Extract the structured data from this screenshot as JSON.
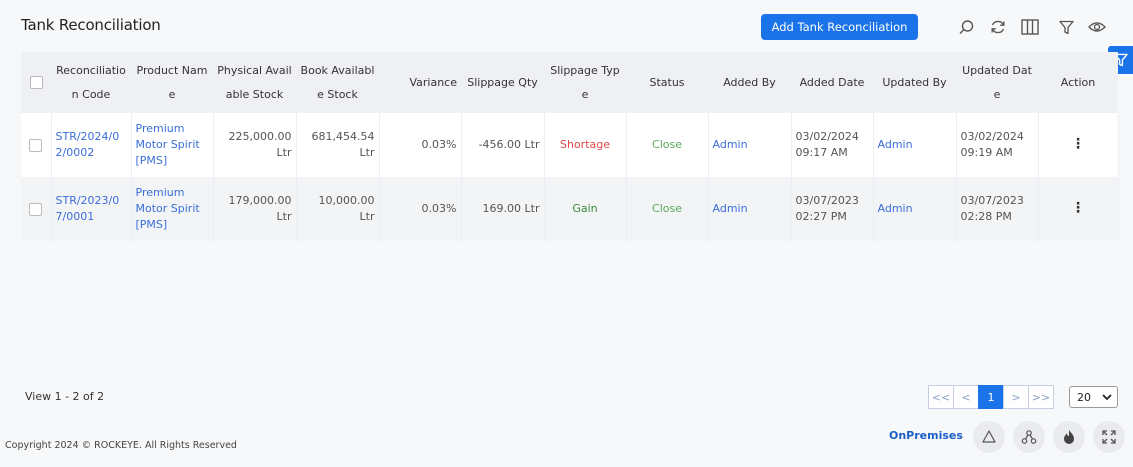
{
  "page": {
    "title": "Tank Reconciliation",
    "add_button": "Add Tank Reconciliation"
  },
  "toolbar": {
    "icons": [
      "search-icon",
      "refresh-icon",
      "columns-icon",
      "filter-icon",
      "eye-icon"
    ]
  },
  "table": {
    "columns": [
      "Reconciliation Code",
      "Product Name",
      "Physical Available Stock",
      "Book Available Stock",
      "Variance",
      "Slippage Qty",
      "Slippage Type",
      "Status",
      "Added By",
      "Added Date",
      "Updated By",
      "Updated Date",
      "Action"
    ],
    "rows": [
      {
        "code": "STR/2024/02/0002",
        "product": "Premium Motor Spirit [PMS]",
        "physical": "225,000.00 Ltr",
        "book": "681,454.54 Ltr",
        "variance": "0.03%",
        "slippage_qty": "-456.00 Ltr",
        "slippage_type": "Shortage",
        "status": "Close",
        "added_by": "Admin",
        "added_date": "03/02/2024 09:17 AM",
        "updated_by": "Admin",
        "updated_date": "03/02/2024 09:19 AM"
      },
      {
        "code": "STR/2023/07/0001",
        "product": "Premium Motor Spirit [PMS]",
        "physical": "179,000.00 Ltr",
        "book": "10,000.00 Ltr",
        "variance": "0.03%",
        "slippage_qty": "169.00 Ltr",
        "slippage_type": "Gain",
        "status": "Close",
        "added_by": "Admin",
        "added_date": "03/07/2023 02:27 PM",
        "updated_by": "Admin",
        "updated_date": "03/07/2023 02:28 PM"
      }
    ]
  },
  "footer": {
    "view_info": "View 1 - 2 of 2",
    "pager": {
      "first": "<<",
      "prev": "<",
      "current": "1",
      "next": ">",
      "last": ">>"
    },
    "per_page": "20",
    "copyright": "Copyright 2024 © ROCKEYE. All Rights Reserved",
    "deployment": "OnPremises"
  },
  "colors": {
    "accent": "#1a73e8",
    "shortage": "#e04848",
    "gain": "#3a8a3a",
    "close": "#5aa85a",
    "link": "#3a6fd8"
  }
}
